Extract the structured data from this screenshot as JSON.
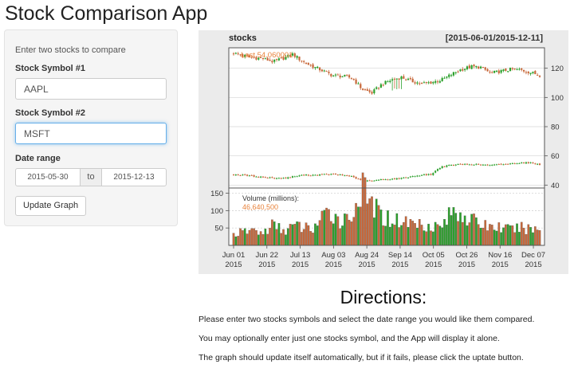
{
  "app": {
    "title": "Stock Comparison App"
  },
  "sidebar": {
    "hint": "Enter two stocks to compare",
    "symbol1_label": "Stock Symbol #1",
    "symbol1_value": "AAPL",
    "symbol2_label": "Stock Symbol #2",
    "symbol2_value": "MSFT",
    "date_label": "Date range",
    "date_start": "2015-05-30",
    "date_sep": "to",
    "date_end": "2015-12-13",
    "update_button": "Update Graph"
  },
  "directions": {
    "title": "Directions:",
    "lines": [
      "Please enter two stocks symbols and select the date range you would like them compared.",
      "You may optionally enter just one stocks symbol, and the App will display it alone.",
      "The graph should update itself automatically, but if it fails, please click the uptate button."
    ]
  },
  "colors": {
    "up": "#2ca02c",
    "down": "#c8683a",
    "accent": "#e8823a",
    "focus": "#66afe9"
  },
  "chart_data": {
    "type": "candlestick",
    "title": "stocks",
    "range_label": "[2015-06-01/2015-12-11]",
    "last_label": "Last 54.060001",
    "price_ylim": [
      38,
      134
    ],
    "price_ticks": [
      120,
      100,
      80,
      60,
      40
    ],
    "volume_label": "Volume (millions):",
    "volume_last": "46,640,500",
    "volume_ylim": [
      0,
      165
    ],
    "volume_ticks": [
      150,
      100,
      50
    ],
    "x_ticks": [
      {
        "date": "2015-06-01",
        "label": "Jun 01",
        "year": "2015"
      },
      {
        "date": "2015-06-22",
        "label": "Jun 22",
        "year": "2015"
      },
      {
        "date": "2015-07-13",
        "label": "Jul 13",
        "year": "2015"
      },
      {
        "date": "2015-08-03",
        "label": "Aug 03",
        "year": "2015"
      },
      {
        "date": "2015-08-24",
        "label": "Aug 24",
        "year": "2015"
      },
      {
        "date": "2015-09-14",
        "label": "Sep 14",
        "year": "2015"
      },
      {
        "date": "2015-10-05",
        "label": "Oct 05",
        "year": "2015"
      },
      {
        "date": "2015-10-26",
        "label": "Oct 26",
        "year": "2015"
      },
      {
        "date": "2015-11-16",
        "label": "Nov 16",
        "year": "2015"
      },
      {
        "date": "2015-12-07",
        "label": "Dec 07",
        "year": "2015"
      }
    ],
    "series": [
      {
        "name": "AAPL",
        "weekly_close": [
          130.3,
          128.6,
          127.2,
          126.7,
          124.5,
          126.8,
          129.6,
          124.5,
          121.3,
          118.4,
          115.1,
          114.6,
          113.4,
          105.8,
          103.1,
          109.0,
          112.1,
          113.8,
          111.2,
          109.5,
          110.3,
          111.8,
          115.5,
          119.1,
          121.0,
          120.8,
          116.7,
          117.8,
          119.2,
          118.9,
          117.3,
          115.2
        ],
        "weekly_volume": [
          32,
          38,
          45,
          34,
          60,
          42,
          55,
          52,
          48,
          78,
          95,
          68,
          90,
          160,
          118,
          82,
          75,
          70,
          65,
          62,
          58,
          52,
          92,
          98,
          72,
          62,
          55,
          52,
          45,
          50,
          48,
          46
        ]
      },
      {
        "name": "MSFT",
        "weekly_close": [
          47.2,
          46.8,
          46.1,
          45.4,
          44.9,
          44.6,
          45.8,
          46.8,
          46.9,
          47.2,
          47.4,
          46.8,
          46.0,
          42.8,
          42.9,
          43.8,
          44.2,
          44.6,
          45.9,
          46.9,
          47.3,
          52.6,
          53.6,
          54.2,
          54.3,
          54.0,
          53.5,
          54.2,
          54.6,
          55.4,
          55.3,
          54.06
        ]
      }
    ]
  }
}
